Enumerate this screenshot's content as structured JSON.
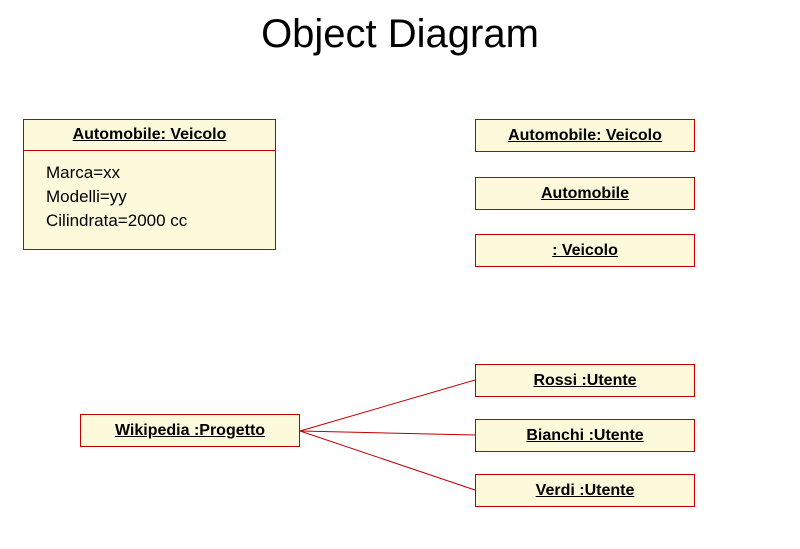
{
  "title": "Object Diagram",
  "topLeftObject": {
    "header": "Automobile: Veicolo",
    "attributes": [
      "Marca=xx",
      "Modelli=yy",
      "Cilindrata=2000 cc"
    ]
  },
  "rightStack": {
    "item1": "Automobile: Veicolo",
    "item2": "Automobile",
    "item3": ": Veicolo"
  },
  "bottom": {
    "project": "Wikipedia :Progetto",
    "user1": "Rossi :Utente",
    "user2": "Bianchi :Utente",
    "user3": "Verdi :Utente"
  }
}
